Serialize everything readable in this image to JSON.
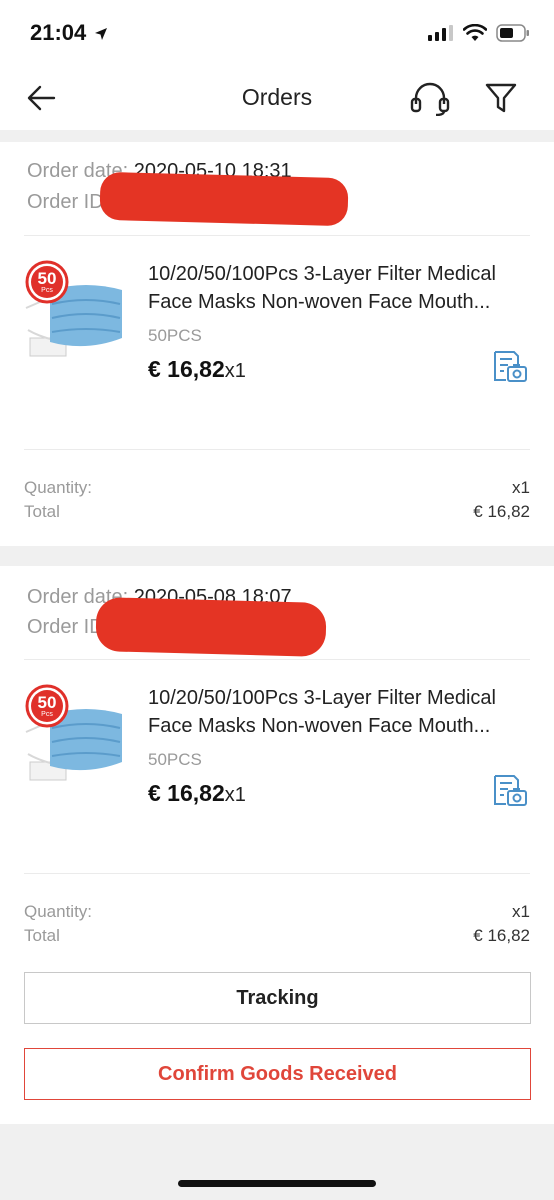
{
  "status": {
    "time": "21:04"
  },
  "header": {
    "title": "Orders"
  },
  "orders": [
    {
      "date_label": "Order date:",
      "date": "2020-05-10 18:31",
      "id_label": "Order ID",
      "product": {
        "badge_number": "50",
        "badge_unit": "Pcs",
        "title": "10/20/50/100Pcs 3-Layer Filter Medical Face Masks Non-woven Face Mouth...",
        "variant": "50PCS",
        "price": "€ 16,82",
        "qty": "x1"
      },
      "quantity_label": "Quantity:",
      "quantity": "x1",
      "total_label": "Total",
      "total": "€ 16,82"
    },
    {
      "date_label": "Order date:",
      "date": "2020-05-08 18:07",
      "id_label": "Order ID",
      "product": {
        "badge_number": "50",
        "badge_unit": "Pcs",
        "title": "10/20/50/100Pcs 3-Layer Filter Medical Face Masks Non-woven Face Mouth...",
        "variant": "50PCS",
        "price": "€ 16,82",
        "qty": "x1"
      },
      "quantity_label": "Quantity:",
      "quantity": "x1",
      "total_label": "Total",
      "total": "€ 16,82",
      "buttons": {
        "tracking": "Tracking",
        "confirm": "Confirm Goods Received"
      }
    }
  ],
  "colors": {
    "accent": "#e0463a",
    "redaction": "#e43424",
    "icon_blue": "#4a90c8"
  }
}
